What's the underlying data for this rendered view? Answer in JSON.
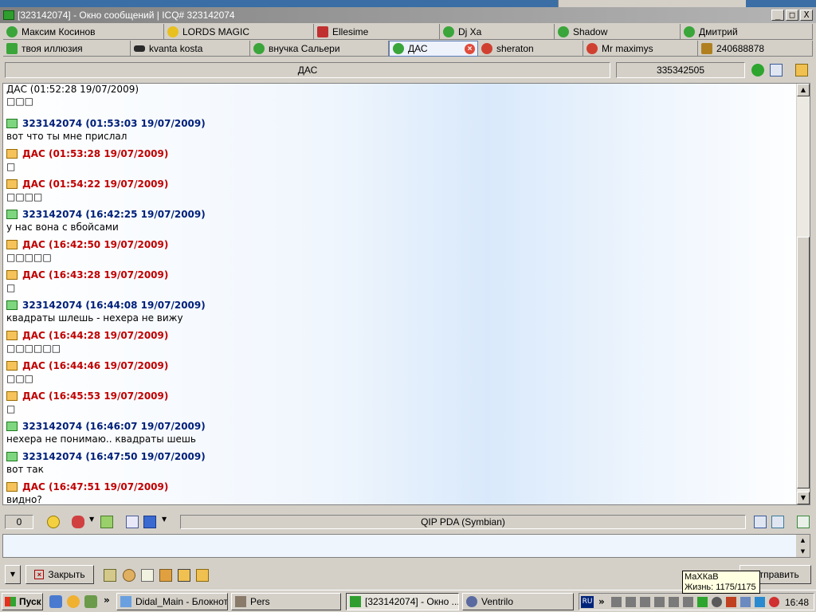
{
  "window": {
    "title": "[323142074] - Окно сообщений | ICQ# 323142074",
    "min_label": "_",
    "max_label": "□",
    "close_label": "X"
  },
  "tabs_row1": [
    {
      "label": "Максим Косинов",
      "icon": "flower-icon",
      "color": "#3aa53a"
    },
    {
      "label": "LORDS MAGIC",
      "icon": "smiley-icon",
      "color": "#e8c020"
    },
    {
      "label": "Ellesime",
      "icon": "ellesime-icon",
      "color": "#c03030"
    },
    {
      "label": "Dj Xa",
      "icon": "flower-icon",
      "color": "#3aa53a"
    },
    {
      "label": "Shadow",
      "icon": "flower-icon",
      "color": "#3aa53a"
    },
    {
      "label": "Дмитрий",
      "icon": "flower-icon",
      "color": "#3aa53a"
    }
  ],
  "tabs_row2": [
    {
      "label": "твоя иллюзия",
      "icon": "star-icon",
      "color": "#3aa53a"
    },
    {
      "label": "kvanta kosta",
      "icon": "sunglasses-icon",
      "color": "#2a2a2a"
    },
    {
      "label": "внучка Сальери",
      "icon": "flower-icon",
      "color": "#3aa53a"
    },
    {
      "label": "ДАС",
      "icon": "flower-icon",
      "color": "#3aa53a"
    },
    {
      "label": "sheraton",
      "icon": "flower-icon",
      "color": "#d04030"
    },
    {
      "label": "Mr maximys",
      "icon": "flower-icon",
      "color": "#d04030"
    },
    {
      "label": "240688878",
      "icon": "na-icon",
      "color": "#b08020"
    }
  ],
  "header": {
    "contact_name": "ДАС",
    "contact_uin": "335342505"
  },
  "messages": [
    {
      "from": "in",
      "header": "ДАС (01:52:28 19/07/2009)",
      "text": "□□□"
    },
    {
      "from": "out",
      "header": "323142074 (01:53:03 19/07/2009)",
      "text": "вот что ты мне прислал"
    },
    {
      "from": "in",
      "header": "ДАС (01:53:28 19/07/2009)",
      "text": "□"
    },
    {
      "from": "in",
      "header": "ДАС (01:54:22 19/07/2009)",
      "text": "□□□□"
    },
    {
      "from": "out",
      "header": "323142074 (16:42:25 19/07/2009)",
      "text": "у нас вона с вбойсами"
    },
    {
      "from": "in",
      "header": "ДАС (16:42:50 19/07/2009)",
      "text": "□□□□□"
    },
    {
      "from": "in",
      "header": "ДАС (16:43:28 19/07/2009)",
      "text": "□"
    },
    {
      "from": "out",
      "header": "323142074 (16:44:08 19/07/2009)",
      "text": "квадраты шлешь - нехера не вижу"
    },
    {
      "from": "in",
      "header": "ДАС (16:44:28 19/07/2009)",
      "text": "□□□□□□"
    },
    {
      "from": "in",
      "header": "ДАС (16:44:46 19/07/2009)",
      "text": "□□□"
    },
    {
      "from": "in",
      "header": "ДАС (16:45:53 19/07/2009)",
      "text": "□"
    },
    {
      "from": "out",
      "header": "323142074 (16:46:07 19/07/2009)",
      "text": "нехера не понимаю.. квадраты шешь"
    },
    {
      "from": "out",
      "header": "323142074 (16:47:50 19/07/2009)",
      "text": "вот так"
    },
    {
      "from": "in",
      "header": "ДАС (16:47:51 19/07/2009)",
      "text": "видно?"
    }
  ],
  "toolbar": {
    "char_count": "0",
    "status_text": "QIP PDA (Symbian)"
  },
  "buttons": {
    "close_label": "Закрыть",
    "send_label": "Отправить"
  },
  "tooltip": {
    "line1": "МаХКаВ",
    "line2": "Жизнь: 1175/1175"
  },
  "taskbar": {
    "start_label": "Пуск",
    "items": [
      {
        "label": "Didal_Main - Блокнот",
        "icon": "notepad-icon"
      },
      {
        "label": "Pers",
        "icon": "pers-icon"
      },
      {
        "label": "[323142074] - Окно ...",
        "icon": "qip-icon"
      },
      {
        "label": "Ventrilo",
        "icon": "ventrilo-icon"
      }
    ],
    "lang": "RU",
    "clock": "16:48"
  },
  "colors": {
    "outgoing_header": "#00207a",
    "incoming_header": "#c00000"
  }
}
